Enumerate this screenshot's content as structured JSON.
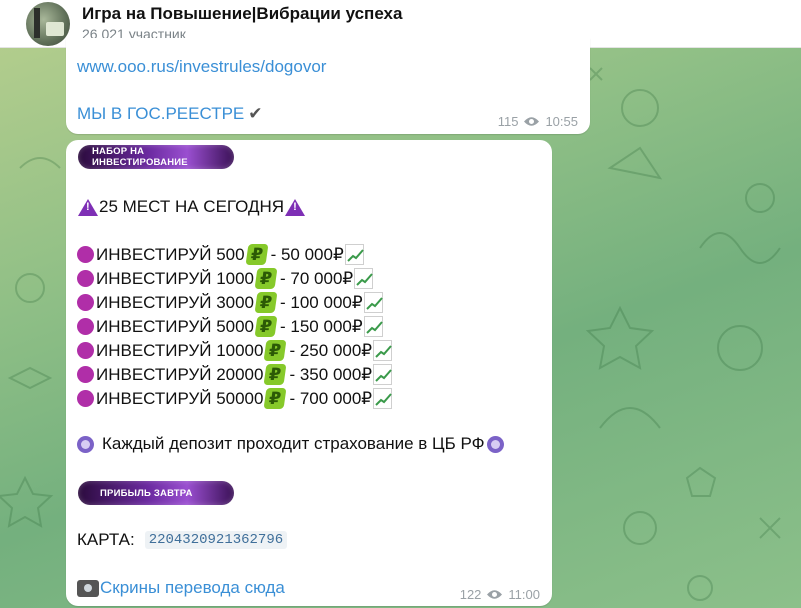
{
  "header": {
    "title": "Игра на Повышение|Вибрации успеха",
    "subtitle": "26 021 участник"
  },
  "message1": {
    "link": "www.ooo.rus/investrules/dogovor",
    "reestr": "МЫ В ГОС.РЕЕСТРЕ",
    "check": "✔",
    "views": "115",
    "time": "10:55"
  },
  "message2": {
    "tag1": "НАБОР НА ИНВЕСТИРОВАНИЕ",
    "headline": "25 МЕСТ НА СЕГОДНЯ",
    "ruble_glyph": "₽",
    "offers": [
      {
        "invest": "ИНВЕСТИРУЙ 500",
        "result": " -  50 000₽"
      },
      {
        "invest": "ИНВЕСТИРУЙ 1000",
        "result": " - 70 000₽"
      },
      {
        "invest": "ИНВЕСТИРУЙ 3000",
        "result": " - 100 000₽"
      },
      {
        "invest": "ИНВЕСТИРУЙ 5000",
        "result": " - 150 000₽"
      },
      {
        "invest": "ИНВЕСТИРУЙ 10000",
        "result": " - 250 000₽"
      },
      {
        "invest": "ИНВЕСТИРУЙ 20000",
        "result": " - 350 000₽"
      },
      {
        "invest": "ИНВЕСТИРУЙ 50000",
        "result": " - 700 000₽"
      }
    ],
    "insurance": "Каждый депозит проходит страхование в ЦБ РФ",
    "tag2": "ПРИБЫЛЬ ЗАВТРА",
    "card_label": "КАРТА:",
    "card_number": "2204320921362796",
    "screens_link": "Скрины перевода сюда",
    "views": "122",
    "time": "11:00"
  },
  "colors": {
    "link": "#3a8fd6",
    "accent_purple": "#7e2fb5",
    "background_green": "#8fbf86"
  },
  "icons": [
    "warning-icon",
    "purple-circle-icon",
    "ruble-sign-icon",
    "chart-up-icon",
    "shield-icon",
    "camera-icon",
    "eye-icon",
    "check-mark-icon"
  ]
}
